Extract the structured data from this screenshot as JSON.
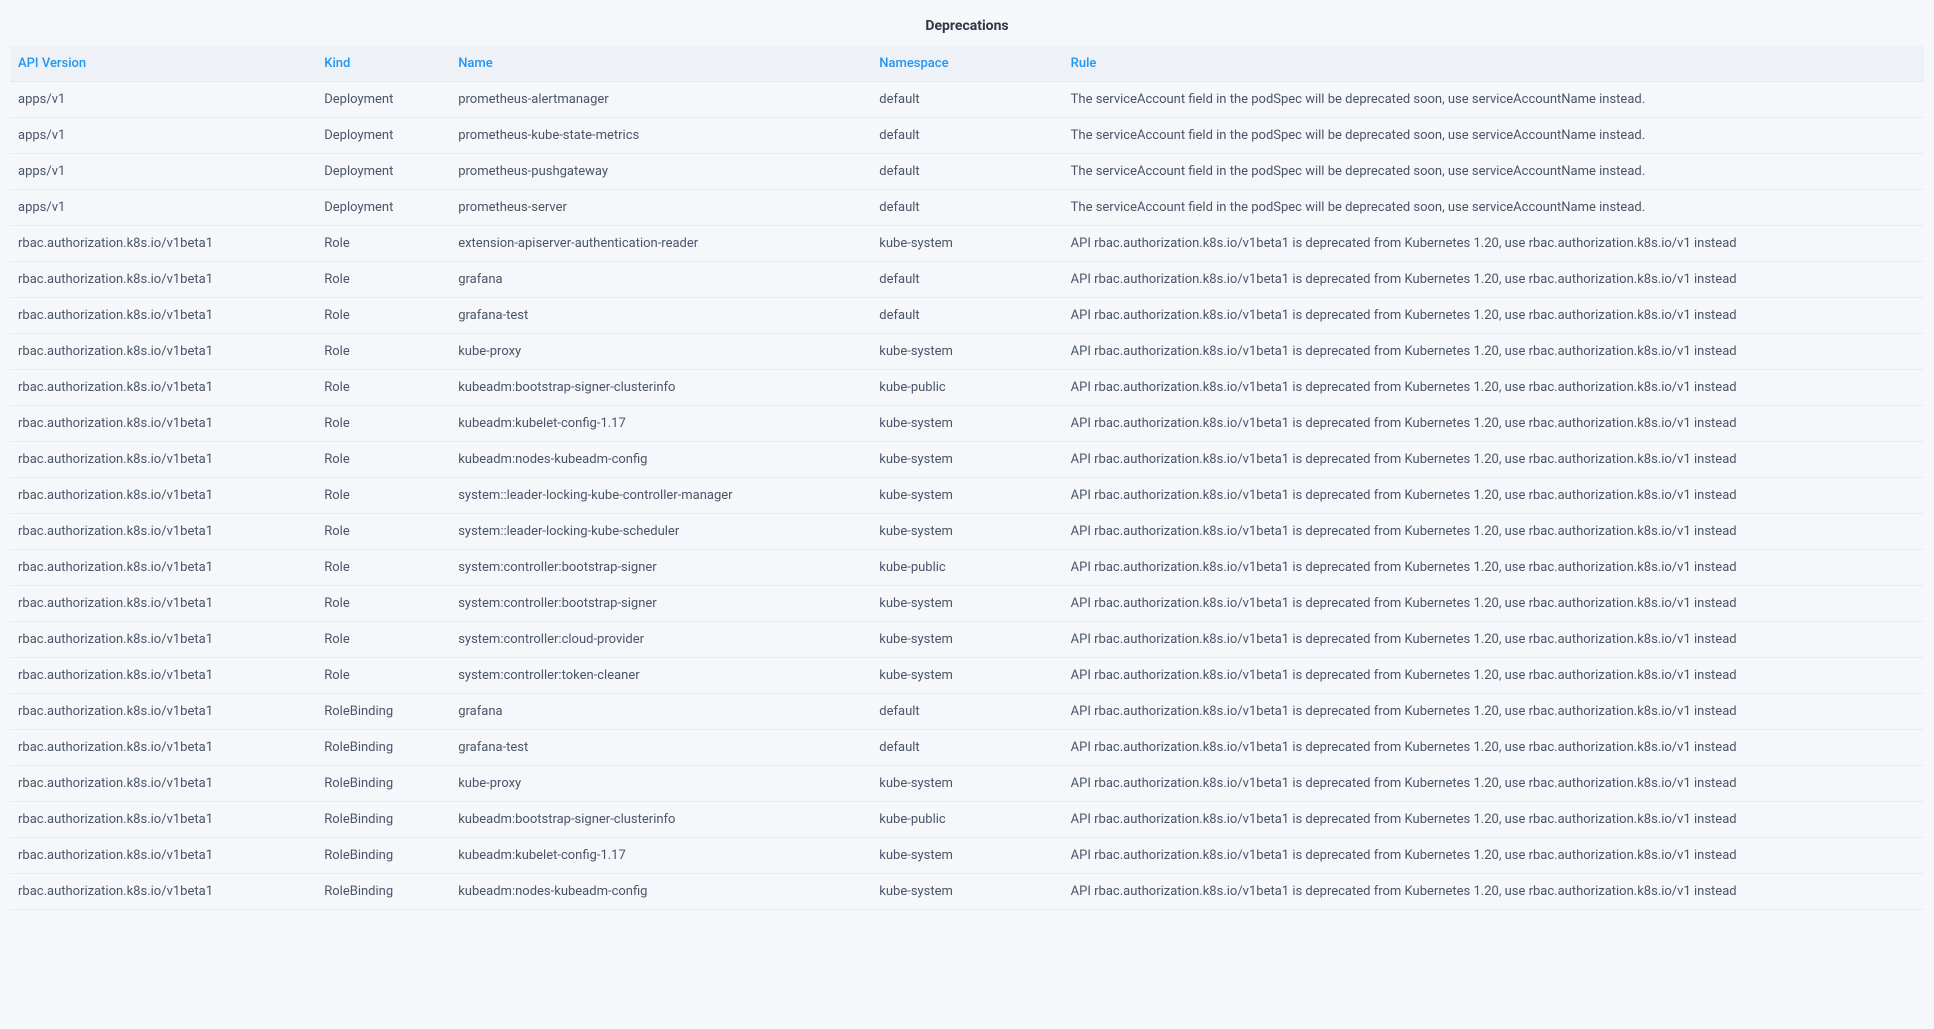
{
  "title": "Deprecations",
  "columns": {
    "apiVersion": "API Version",
    "kind": "Kind",
    "name": "Name",
    "namespace": "Namespace",
    "rule": "Rule"
  },
  "rows": [
    {
      "apiVersion": "apps/v1",
      "kind": "Deployment",
      "name": "prometheus-alertmanager",
      "namespace": "default",
      "rule": "The serviceAccount field in the podSpec will be deprecated soon, use serviceAccountName instead."
    },
    {
      "apiVersion": "apps/v1",
      "kind": "Deployment",
      "name": "prometheus-kube-state-metrics",
      "namespace": "default",
      "rule": "The serviceAccount field in the podSpec will be deprecated soon, use serviceAccountName instead."
    },
    {
      "apiVersion": "apps/v1",
      "kind": "Deployment",
      "name": "prometheus-pushgateway",
      "namespace": "default",
      "rule": "The serviceAccount field in the podSpec will be deprecated soon, use serviceAccountName instead."
    },
    {
      "apiVersion": "apps/v1",
      "kind": "Deployment",
      "name": "prometheus-server",
      "namespace": "default",
      "rule": "The serviceAccount field in the podSpec will be deprecated soon, use serviceAccountName instead."
    },
    {
      "apiVersion": "rbac.authorization.k8s.io/v1beta1",
      "kind": "Role",
      "name": "extension-apiserver-authentication-reader",
      "namespace": "kube-system",
      "rule": "API rbac.authorization.k8s.io/v1beta1 is deprecated from Kubernetes 1.20, use rbac.authorization.k8s.io/v1 instead"
    },
    {
      "apiVersion": "rbac.authorization.k8s.io/v1beta1",
      "kind": "Role",
      "name": "grafana",
      "namespace": "default",
      "rule": "API rbac.authorization.k8s.io/v1beta1 is deprecated from Kubernetes 1.20, use rbac.authorization.k8s.io/v1 instead"
    },
    {
      "apiVersion": "rbac.authorization.k8s.io/v1beta1",
      "kind": "Role",
      "name": "grafana-test",
      "namespace": "default",
      "rule": "API rbac.authorization.k8s.io/v1beta1 is deprecated from Kubernetes 1.20, use rbac.authorization.k8s.io/v1 instead"
    },
    {
      "apiVersion": "rbac.authorization.k8s.io/v1beta1",
      "kind": "Role",
      "name": "kube-proxy",
      "namespace": "kube-system",
      "rule": "API rbac.authorization.k8s.io/v1beta1 is deprecated from Kubernetes 1.20, use rbac.authorization.k8s.io/v1 instead"
    },
    {
      "apiVersion": "rbac.authorization.k8s.io/v1beta1",
      "kind": "Role",
      "name": "kubeadm:bootstrap-signer-clusterinfo",
      "namespace": "kube-public",
      "rule": "API rbac.authorization.k8s.io/v1beta1 is deprecated from Kubernetes 1.20, use rbac.authorization.k8s.io/v1 instead"
    },
    {
      "apiVersion": "rbac.authorization.k8s.io/v1beta1",
      "kind": "Role",
      "name": "kubeadm:kubelet-config-1.17",
      "namespace": "kube-system",
      "rule": "API rbac.authorization.k8s.io/v1beta1 is deprecated from Kubernetes 1.20, use rbac.authorization.k8s.io/v1 instead"
    },
    {
      "apiVersion": "rbac.authorization.k8s.io/v1beta1",
      "kind": "Role",
      "name": "kubeadm:nodes-kubeadm-config",
      "namespace": "kube-system",
      "rule": "API rbac.authorization.k8s.io/v1beta1 is deprecated from Kubernetes 1.20, use rbac.authorization.k8s.io/v1 instead"
    },
    {
      "apiVersion": "rbac.authorization.k8s.io/v1beta1",
      "kind": "Role",
      "name": "system::leader-locking-kube-controller-manager",
      "namespace": "kube-system",
      "rule": "API rbac.authorization.k8s.io/v1beta1 is deprecated from Kubernetes 1.20, use rbac.authorization.k8s.io/v1 instead"
    },
    {
      "apiVersion": "rbac.authorization.k8s.io/v1beta1",
      "kind": "Role",
      "name": "system::leader-locking-kube-scheduler",
      "namespace": "kube-system",
      "rule": "API rbac.authorization.k8s.io/v1beta1 is deprecated from Kubernetes 1.20, use rbac.authorization.k8s.io/v1 instead"
    },
    {
      "apiVersion": "rbac.authorization.k8s.io/v1beta1",
      "kind": "Role",
      "name": "system:controller:bootstrap-signer",
      "namespace": "kube-public",
      "rule": "API rbac.authorization.k8s.io/v1beta1 is deprecated from Kubernetes 1.20, use rbac.authorization.k8s.io/v1 instead"
    },
    {
      "apiVersion": "rbac.authorization.k8s.io/v1beta1",
      "kind": "Role",
      "name": "system:controller:bootstrap-signer",
      "namespace": "kube-system",
      "rule": "API rbac.authorization.k8s.io/v1beta1 is deprecated from Kubernetes 1.20, use rbac.authorization.k8s.io/v1 instead"
    },
    {
      "apiVersion": "rbac.authorization.k8s.io/v1beta1",
      "kind": "Role",
      "name": "system:controller:cloud-provider",
      "namespace": "kube-system",
      "rule": "API rbac.authorization.k8s.io/v1beta1 is deprecated from Kubernetes 1.20, use rbac.authorization.k8s.io/v1 instead"
    },
    {
      "apiVersion": "rbac.authorization.k8s.io/v1beta1",
      "kind": "Role",
      "name": "system:controller:token-cleaner",
      "namespace": "kube-system",
      "rule": "API rbac.authorization.k8s.io/v1beta1 is deprecated from Kubernetes 1.20, use rbac.authorization.k8s.io/v1 instead"
    },
    {
      "apiVersion": "rbac.authorization.k8s.io/v1beta1",
      "kind": "RoleBinding",
      "name": "grafana",
      "namespace": "default",
      "rule": "API rbac.authorization.k8s.io/v1beta1 is deprecated from Kubernetes 1.20, use rbac.authorization.k8s.io/v1 instead"
    },
    {
      "apiVersion": "rbac.authorization.k8s.io/v1beta1",
      "kind": "RoleBinding",
      "name": "grafana-test",
      "namespace": "default",
      "rule": "API rbac.authorization.k8s.io/v1beta1 is deprecated from Kubernetes 1.20, use rbac.authorization.k8s.io/v1 instead"
    },
    {
      "apiVersion": "rbac.authorization.k8s.io/v1beta1",
      "kind": "RoleBinding",
      "name": "kube-proxy",
      "namespace": "kube-system",
      "rule": "API rbac.authorization.k8s.io/v1beta1 is deprecated from Kubernetes 1.20, use rbac.authorization.k8s.io/v1 instead"
    },
    {
      "apiVersion": "rbac.authorization.k8s.io/v1beta1",
      "kind": "RoleBinding",
      "name": "kubeadm:bootstrap-signer-clusterinfo",
      "namespace": "kube-public",
      "rule": "API rbac.authorization.k8s.io/v1beta1 is deprecated from Kubernetes 1.20, use rbac.authorization.k8s.io/v1 instead"
    },
    {
      "apiVersion": "rbac.authorization.k8s.io/v1beta1",
      "kind": "RoleBinding",
      "name": "kubeadm:kubelet-config-1.17",
      "namespace": "kube-system",
      "rule": "API rbac.authorization.k8s.io/v1beta1 is deprecated from Kubernetes 1.20, use rbac.authorization.k8s.io/v1 instead"
    },
    {
      "apiVersion": "rbac.authorization.k8s.io/v1beta1",
      "kind": "RoleBinding",
      "name": "kubeadm:nodes-kubeadm-config",
      "namespace": "kube-system",
      "rule": "API rbac.authorization.k8s.io/v1beta1 is deprecated from Kubernetes 1.20, use rbac.authorization.k8s.io/v1 instead"
    }
  ]
}
